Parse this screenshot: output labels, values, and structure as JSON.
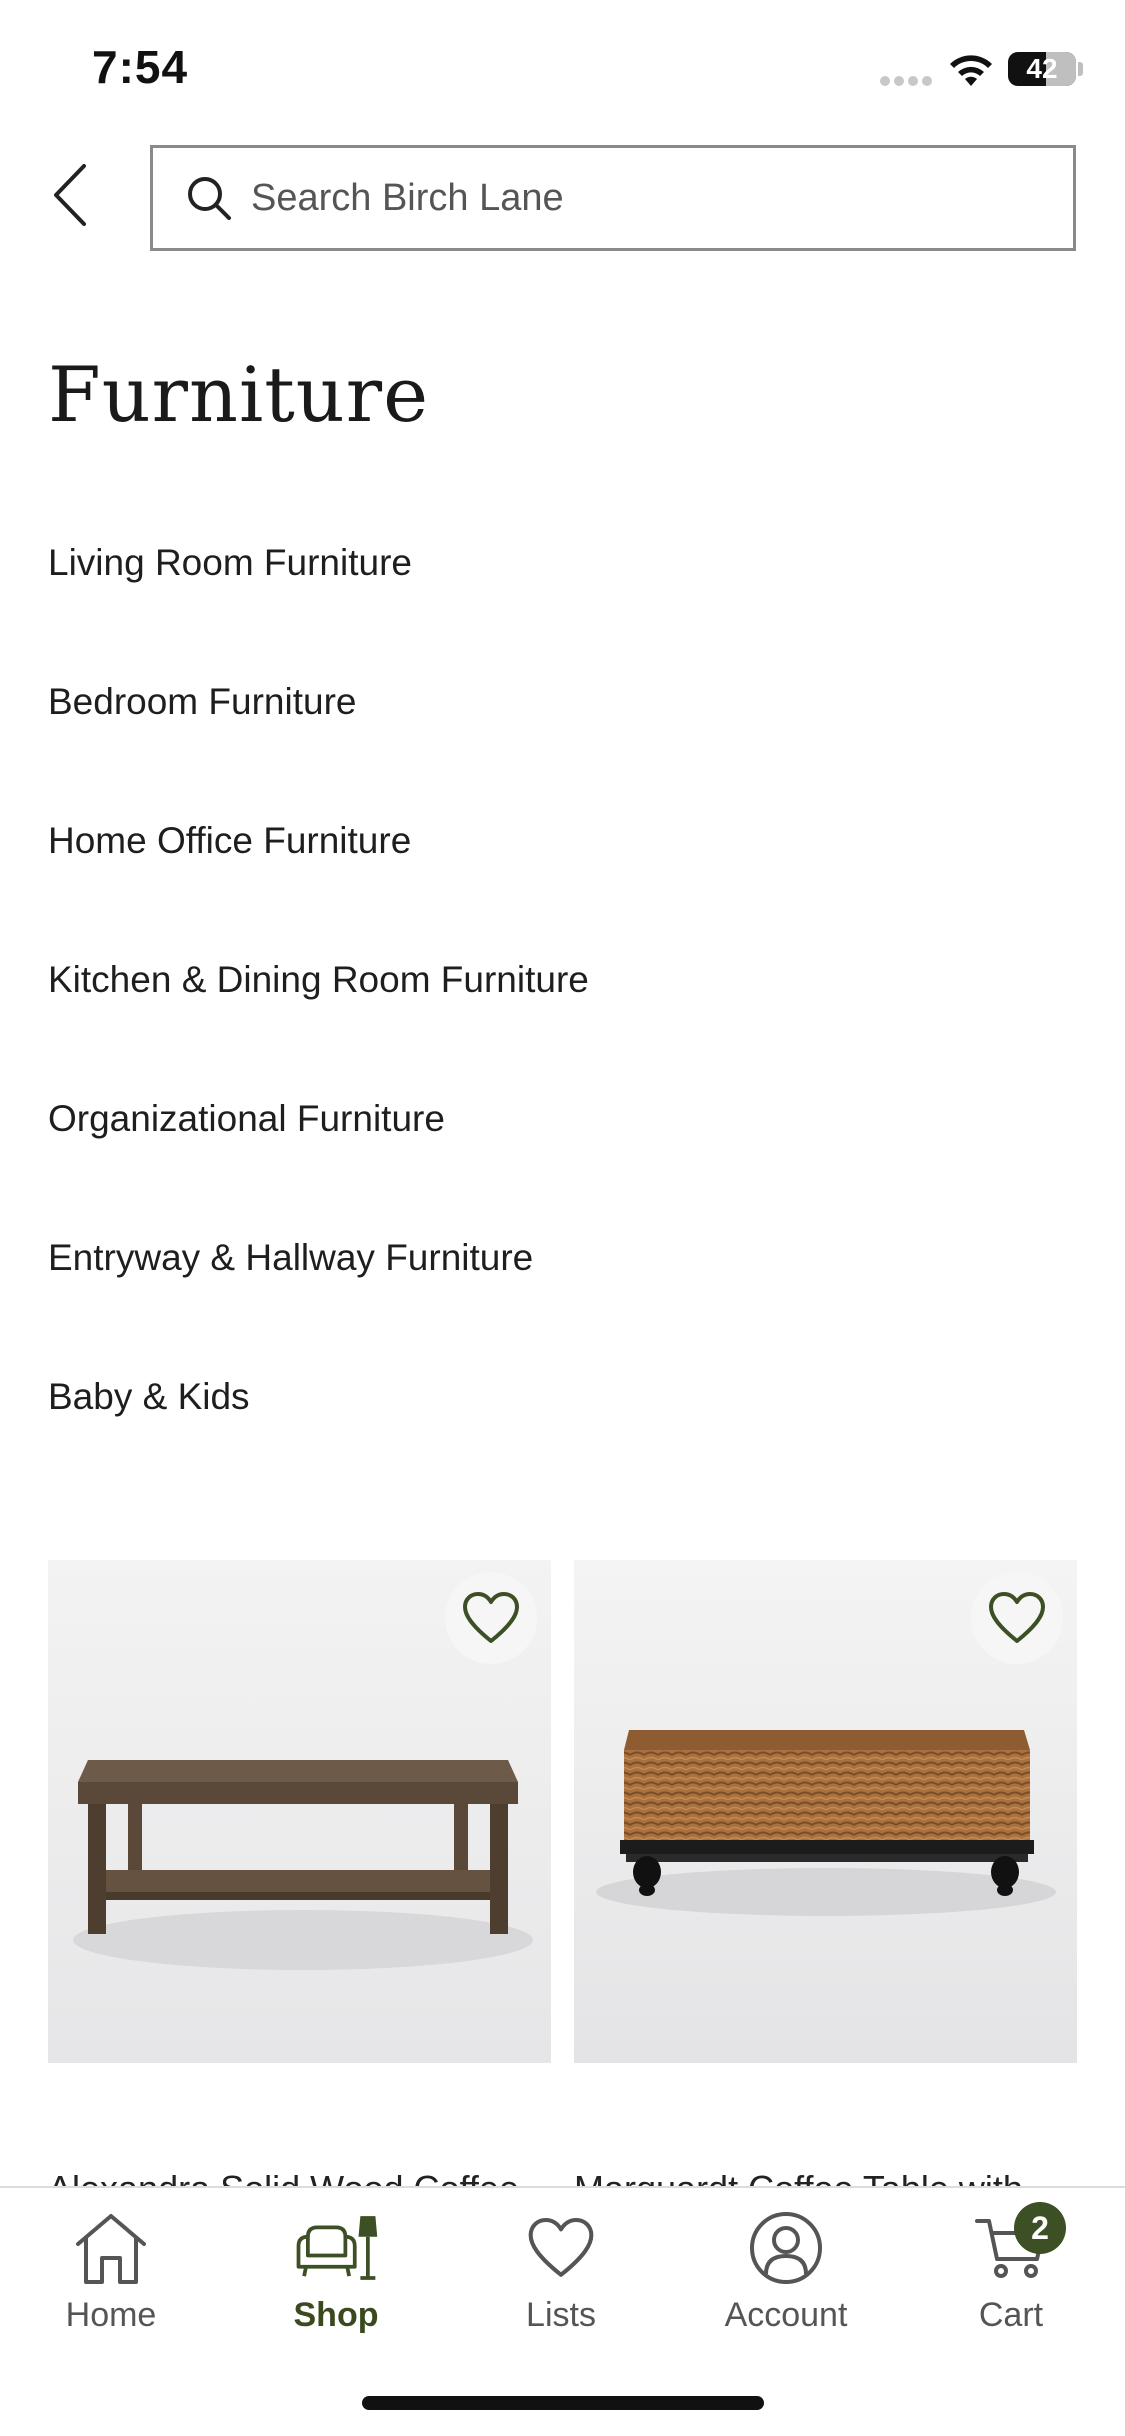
{
  "status_bar": {
    "time": "7:54",
    "battery_level": "42"
  },
  "header": {
    "search_placeholder": "Search Birch Lane"
  },
  "page": {
    "title": "Furniture"
  },
  "categories": [
    {
      "label": "Living Room Furniture"
    },
    {
      "label": "Bedroom Furniture"
    },
    {
      "label": "Home Office Furniture"
    },
    {
      "label": "Kitchen & Dining Room Furniture"
    },
    {
      "label": "Organizational Furniture"
    },
    {
      "label": "Entryway & Hallway Furniture"
    },
    {
      "label": "Baby & Kids"
    }
  ],
  "products": [
    {
      "name": "Alexandra Solid Wood Coffee",
      "image": "wood-coffee-table",
      "favorited": false
    },
    {
      "name": "Marquardt Coffee Table with",
      "image": "woven-coffee-table",
      "favorited": false
    }
  ],
  "tab_bar": {
    "tabs": [
      {
        "label": "Home",
        "icon": "home-icon",
        "active": false
      },
      {
        "label": "Shop",
        "icon": "shop-icon",
        "active": true
      },
      {
        "label": "Lists",
        "icon": "heart-icon",
        "active": false
      },
      {
        "label": "Account",
        "icon": "account-icon",
        "active": false
      },
      {
        "label": "Cart",
        "icon": "cart-icon",
        "active": false
      }
    ],
    "cart_count": "2"
  },
  "colors": {
    "accent": "#3d4f24",
    "text": "#222222",
    "border": "#8a8a8a"
  }
}
